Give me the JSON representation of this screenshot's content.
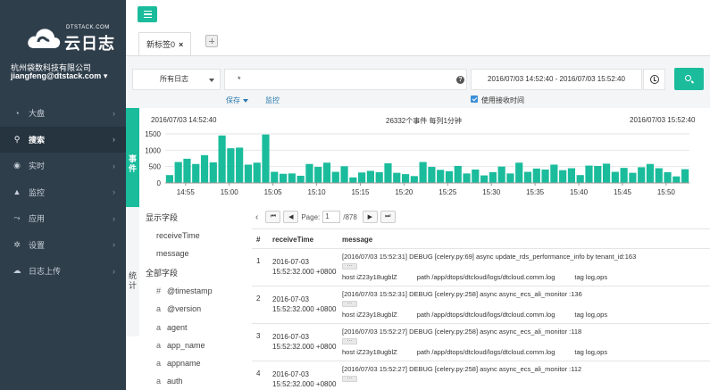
{
  "sidebar": {
    "logo_sub": "DTSTACK.COM",
    "logo_main": "云日志",
    "company": "杭州袋数科技有限公司",
    "account": "jiangfeng@dtstack.com",
    "items": [
      {
        "label": "大盘",
        "icon": "dashboard-icon"
      },
      {
        "label": "搜索",
        "icon": "search-icon",
        "active": true
      },
      {
        "label": "实时",
        "icon": "eye-icon"
      },
      {
        "label": "监控",
        "icon": "bell-icon"
      },
      {
        "label": "应用",
        "icon": "share-icon"
      },
      {
        "label": "设置",
        "icon": "gear-icon"
      },
      {
        "label": "日志上传",
        "icon": "cloud-upload-icon"
      }
    ],
    "bg_color": "#2f3e4b"
  },
  "tabs": {
    "active_label": "新标签0",
    "close_glyph": "×"
  },
  "search": {
    "select_value": "所有日志",
    "query": "*",
    "help_glyph": "?",
    "time_range": "2016/07/03 14:52:40 - 2016/07/03 15:52:40",
    "save_label": "保存",
    "monitor_label": "监控",
    "receive_time_label": "使用接收时间",
    "receive_time_checked": true
  },
  "events": {
    "strip_label": "事件",
    "start": "2016/07/03 14:52:40",
    "summary": "26332个事件 每列1分钟",
    "end": "2016/07/03 15:52:40"
  },
  "chart_data": {
    "type": "bar",
    "ylim": [
      0,
      1500
    ],
    "y_ticks": [
      0,
      500,
      1000,
      1500
    ],
    "x_ticks": [
      "14:55",
      "15:00",
      "15:05",
      "15:10",
      "15:15",
      "15:20",
      "15:25",
      "15:30",
      "15:35",
      "15:40",
      "15:45",
      "15:50"
    ],
    "x_tick_minutes": [
      2.33,
      7.33,
      12.33,
      17.33,
      22.33,
      27.33,
      32.33,
      37.33,
      42.33,
      47.33,
      52.33,
      57.33
    ],
    "values": [
      240,
      640,
      740,
      580,
      850,
      630,
      1450,
      1060,
      1080,
      560,
      620,
      1480,
      340,
      280,
      290,
      220,
      580,
      490,
      620,
      340,
      510,
      170,
      320,
      370,
      330,
      600,
      310,
      270,
      210,
      640,
      490,
      400,
      360,
      520,
      290,
      410,
      230,
      330,
      500,
      290,
      620,
      340,
      440,
      410,
      560,
      390,
      450,
      240,
      530,
      520,
      590,
      340,
      460,
      310,
      480,
      580,
      450,
      330,
      200,
      420
    ],
    "color": "#1abc9c"
  },
  "fields": {
    "shown_header": "显示字段",
    "shown": [
      "receiveTime",
      "message"
    ],
    "all_header": "全部字段",
    "all": [
      {
        "type": "#",
        "name": "@timestamp"
      },
      {
        "type": "a",
        "name": "@version"
      },
      {
        "type": "a",
        "name": "agent"
      },
      {
        "type": "a",
        "name": "app_name"
      },
      {
        "type": "a",
        "name": "appname"
      },
      {
        "type": "a",
        "name": "auth"
      }
    ],
    "stats_label": "统计"
  },
  "pager": {
    "page_label": "Page:",
    "page": "1",
    "total": "/878"
  },
  "results": {
    "headers": {
      "num": "#",
      "time": "receiveTime",
      "message": "message"
    },
    "rows": [
      {
        "num": "1",
        "date": "2016-07-03",
        "time": "15:52:32.000 +0800",
        "message": "[2016/07/03 15:52:31] DEBUG [celery.py:69] async update_rds_performance_info by tenant_id:163",
        "host": "host iZ23y18ugblZ",
        "path": "path /app/dtops/dtcloud/logs/dtcloud.comm.log",
        "tag": "tag log,ops"
      },
      {
        "num": "2",
        "date": "2016-07-03",
        "time": "15:52:32.000 +0800",
        "message": "[2016/07/03 15:52:31] DEBUG [celery.py:258] async async_ecs_ali_monitor :136",
        "host": "host iZ23y18ugblZ",
        "path": "path /app/dtops/dtcloud/logs/dtcloud.comm.log",
        "tag": "tag log,ops"
      },
      {
        "num": "3",
        "date": "2016-07-03",
        "time": "15:52:32.000 +0800",
        "message": "[2016/07/03 15:52:27] DEBUG [celery.py:258] async async_ecs_ali_monitor :118",
        "host": "host iZ23y18ugblZ",
        "path": "path /app/dtops/dtcloud/logs/dtcloud.comm.log",
        "tag": "tag log,ops"
      },
      {
        "num": "4",
        "date": "2016-07-03",
        "time": "15:52:32.000 +0800",
        "message": "[2016/07/03 15:52:27] DEBUG [celery.py:258] async async_ecs_ali_monitor :112",
        "host": "",
        "path": "",
        "tag": ""
      }
    ],
    "more_glyph": "···"
  }
}
